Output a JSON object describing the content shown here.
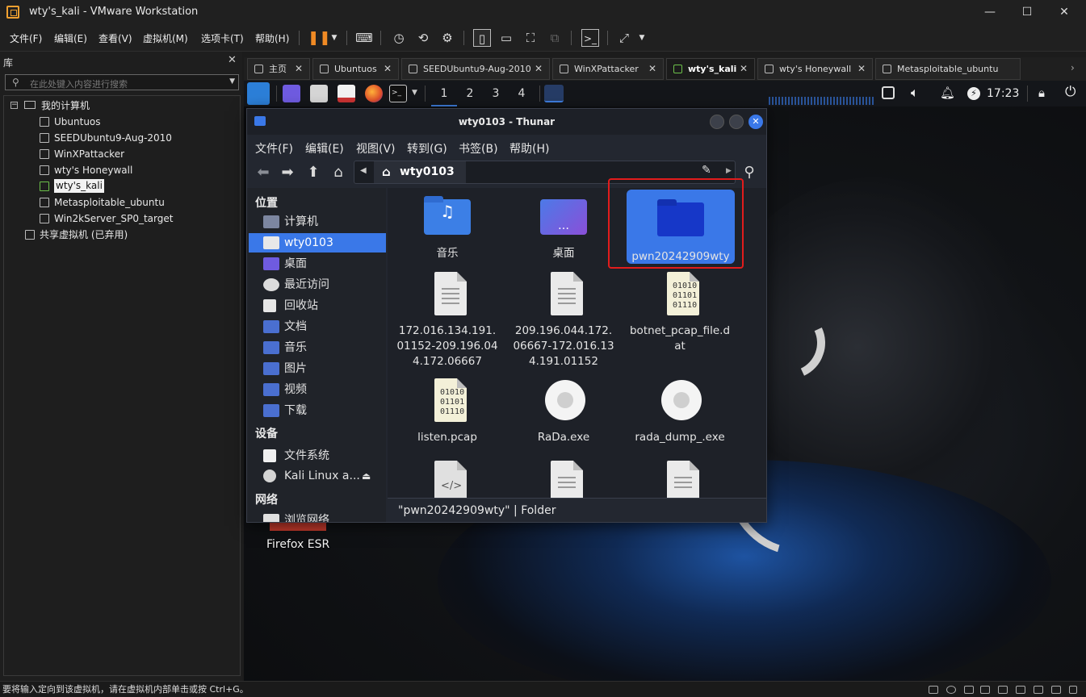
{
  "window": {
    "title": "wty's_kali - VMware Workstation",
    "minimize": "—",
    "maximize": "☐",
    "close": "✕"
  },
  "menubar": {
    "items": [
      "文件(F)",
      "编辑(E)",
      "查看(V)",
      "虚拟机(M)",
      "选项卡(T)",
      "帮助(H)"
    ]
  },
  "library": {
    "header": "库",
    "close": "✕",
    "search_placeholder": "在此处键入内容进行搜索",
    "root": "我的计算机",
    "vms": [
      "Ubuntuos",
      "SEEDUbuntu9-Aug-2010",
      "WinXPattacker",
      "wty's Honeywall",
      "wty's_kali",
      "Metasploitable_ubuntu",
      "Win2kServer_SP0_target"
    ],
    "selected": "wty's_kali",
    "shared": "共享虚拟机 (已弃用)"
  },
  "vm_tabs": [
    {
      "label": "主页",
      "active": false
    },
    {
      "label": "Ubuntuos",
      "active": false
    },
    {
      "label": "SEEDUbuntu9-Aug-2010",
      "active": false
    },
    {
      "label": "WinXPattacker",
      "active": false
    },
    {
      "label": "wty's_kali",
      "active": true
    },
    {
      "label": "wty's Honeywall",
      "active": false
    },
    {
      "label": "Metasploitable_ubuntu",
      "active": false
    }
  ],
  "kali_panel": {
    "workspaces": [
      "1",
      "2",
      "3",
      "4"
    ],
    "active_workspace": "1",
    "clock": "17:23"
  },
  "desktop": {
    "icon_label": "Firefox ESR"
  },
  "thunar": {
    "title": "wty0103 - Thunar",
    "menu": [
      "文件(F)",
      "编辑(E)",
      "视图(V)",
      "转到(G)",
      "书签(B)",
      "帮助(H)"
    ],
    "path": "wty0103",
    "sidebar": {
      "places_header": "位置",
      "places": [
        "计算机",
        "wty0103",
        "桌面",
        "最近访问",
        "回收站",
        "文档",
        "音乐",
        "图片",
        "视频",
        "下载"
      ],
      "selected_place": "wty0103",
      "devices_header": "设备",
      "devices": [
        "文件系统",
        "Kali Linux a..."
      ],
      "network_header": "网络",
      "network": [
        "浏览网络"
      ]
    },
    "files": [
      {
        "name": "音乐",
        "kind": "music-folder"
      },
      {
        "name": "桌面",
        "kind": "desktop-folder"
      },
      {
        "name": "pwn20242909wty",
        "kind": "folder",
        "selected": true
      },
      {
        "name": "172.016.134.191.01152-209.196.044.172.06667",
        "kind": "text"
      },
      {
        "name": "209.196.044.172.06667-172.016.134.191.01152",
        "kind": "text"
      },
      {
        "name": "botnet_pcap_file.dat",
        "kind": "binary"
      },
      {
        "name": "listen.pcap",
        "kind": "binary"
      },
      {
        "name": "RaDa.exe",
        "kind": "executable"
      },
      {
        "name": "rada_dump_.exe",
        "kind": "executable"
      },
      {
        "name": "",
        "kind": "code"
      },
      {
        "name": "",
        "kind": "text"
      },
      {
        "name": "",
        "kind": "text"
      }
    ],
    "status": "\"pwn20242909wty\" | Folder"
  },
  "statusbar": {
    "text": "要将输入定向到该虚拟机，请在虚拟机内部单击或按 Ctrl+G。"
  },
  "colors": {
    "accent": "#3a78e8",
    "highlight_box": "#e21c1c",
    "pause": "#f08a24"
  }
}
